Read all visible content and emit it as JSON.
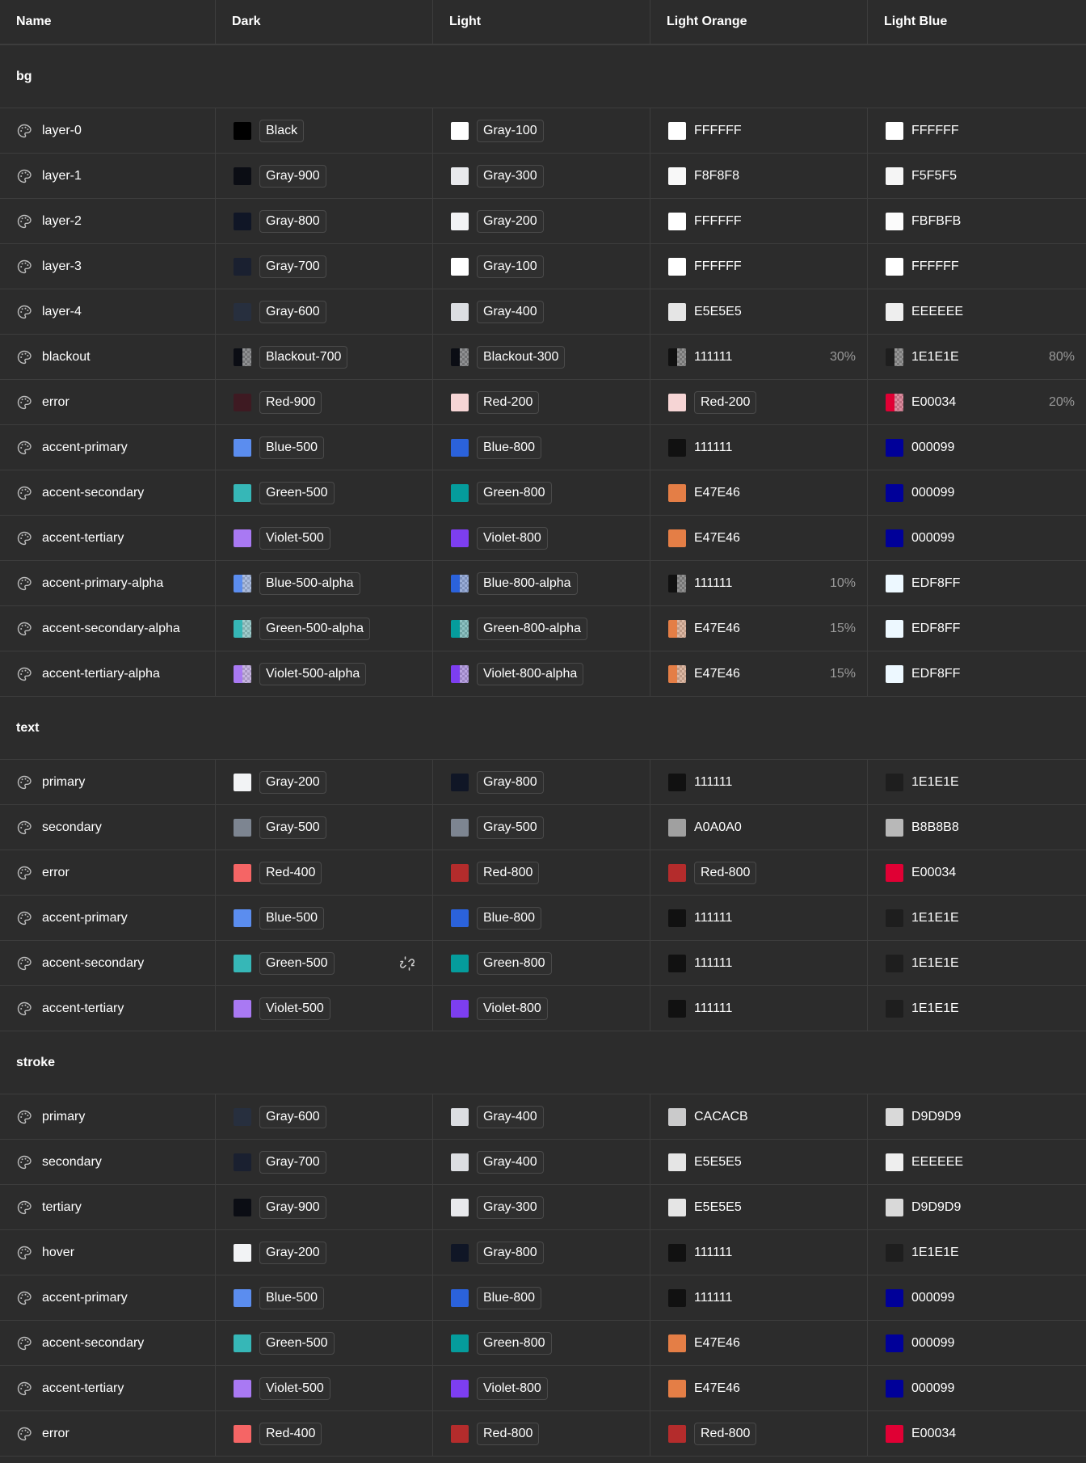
{
  "columns": [
    "Name",
    "Dark",
    "Light",
    "Light Orange",
    "Light Blue"
  ],
  "icons": {
    "row_icon": "palette-icon",
    "link_icon": "link-icon"
  },
  "sections": [
    {
      "title": "bg",
      "rows": [
        {
          "name": "layer-0",
          "cells": [
            {
              "type": "token",
              "label": "Black",
              "color": "#000000"
            },
            {
              "type": "token",
              "label": "Gray-100",
              "color": "#ffffff"
            },
            {
              "type": "hex",
              "label": "FFFFFF",
              "color": "#ffffff"
            },
            {
              "type": "hex",
              "label": "FFFFFF",
              "color": "#ffffff"
            }
          ]
        },
        {
          "name": "layer-1",
          "cells": [
            {
              "type": "token",
              "label": "Gray-900",
              "color": "#0b0d14"
            },
            {
              "type": "token",
              "label": "Gray-300",
              "color": "#e8e9ec"
            },
            {
              "type": "hex",
              "label": "F8F8F8",
              "color": "#f8f8f8"
            },
            {
              "type": "hex",
              "label": "F5F5F5",
              "color": "#f5f5f5"
            }
          ]
        },
        {
          "name": "layer-2",
          "cells": [
            {
              "type": "token",
              "label": "Gray-800",
              "color": "#101626"
            },
            {
              "type": "token",
              "label": "Gray-200",
              "color": "#f2f3f5"
            },
            {
              "type": "hex",
              "label": "FFFFFF",
              "color": "#ffffff"
            },
            {
              "type": "hex",
              "label": "FBFBFB",
              "color": "#fbfbfb"
            }
          ]
        },
        {
          "name": "layer-3",
          "cells": [
            {
              "type": "token",
              "label": "Gray-700",
              "color": "#1a2030"
            },
            {
              "type": "token",
              "label": "Gray-100",
              "color": "#ffffff"
            },
            {
              "type": "hex",
              "label": "FFFFFF",
              "color": "#ffffff"
            },
            {
              "type": "hex",
              "label": "FFFFFF",
              "color": "#ffffff"
            }
          ]
        },
        {
          "name": "layer-4",
          "cells": [
            {
              "type": "token",
              "label": "Gray-600",
              "color": "#272f3e"
            },
            {
              "type": "token",
              "label": "Gray-400",
              "color": "#dcdee2"
            },
            {
              "type": "hex",
              "label": "E5E5E5",
              "color": "#e5e5e5"
            },
            {
              "type": "hex",
              "label": "EEEEEE",
              "color": "#eeeeee"
            }
          ]
        },
        {
          "name": "blackout",
          "cells": [
            {
              "type": "token",
              "label": "Blackout-700",
              "color": "#0b0d14",
              "alpha": true
            },
            {
              "type": "token",
              "label": "Blackout-300",
              "color": "#0b0d14",
              "alpha": true
            },
            {
              "type": "hex",
              "label": "111111",
              "color": "#111111",
              "alpha": true,
              "pct": "30%"
            },
            {
              "type": "hex",
              "label": "1E1E1E",
              "color": "#1e1e1e",
              "alpha": true,
              "pct": "80%"
            }
          ]
        },
        {
          "name": "error",
          "cells": [
            {
              "type": "token",
              "label": "Red-900",
              "color": "#3e1a22"
            },
            {
              "type": "token",
              "label": "Red-200",
              "color": "#f6d5d5"
            },
            {
              "type": "token",
              "label": "Red-200",
              "color": "#f6d5d5"
            },
            {
              "type": "hex",
              "label": "E00034",
              "color": "#e00034",
              "alpha": true,
              "pct": "20%"
            }
          ]
        },
        {
          "name": "accent-primary",
          "cells": [
            {
              "type": "token",
              "label": "Blue-500",
              "color": "#5b8def"
            },
            {
              "type": "token",
              "label": "Blue-800",
              "color": "#2b62db"
            },
            {
              "type": "hex",
              "label": "111111",
              "color": "#111111"
            },
            {
              "type": "hex",
              "label": "000099",
              "color": "#000099"
            }
          ]
        },
        {
          "name": "accent-secondary",
          "cells": [
            {
              "type": "token",
              "label": "Green-500",
              "color": "#36b7b7"
            },
            {
              "type": "token",
              "label": "Green-800",
              "color": "#059c9c"
            },
            {
              "type": "hex",
              "label": "E47E46",
              "color": "#e47e46"
            },
            {
              "type": "hex",
              "label": "000099",
              "color": "#000099"
            }
          ]
        },
        {
          "name": "accent-tertiary",
          "cells": [
            {
              "type": "token",
              "label": "Violet-500",
              "color": "#a979f3"
            },
            {
              "type": "token",
              "label": "Violet-800",
              "color": "#7d3ef0"
            },
            {
              "type": "hex",
              "label": "E47E46",
              "color": "#e47e46"
            },
            {
              "type": "hex",
              "label": "000099",
              "color": "#000099"
            }
          ]
        },
        {
          "name": "accent-primary-alpha",
          "cells": [
            {
              "type": "token",
              "label": "Blue-500-alpha",
              "color": "#5b8def",
              "alpha": true
            },
            {
              "type": "token",
              "label": "Blue-800-alpha",
              "color": "#2b62db",
              "alpha": true
            },
            {
              "type": "hex",
              "label": "111111",
              "color": "#111111",
              "alpha": true,
              "pct": "10%"
            },
            {
              "type": "hex",
              "label": "EDF8FF",
              "color": "#edf8ff"
            }
          ]
        },
        {
          "name": "accent-secondary-alpha",
          "cells": [
            {
              "type": "token",
              "label": "Green-500-alpha",
              "color": "#36b7b7",
              "alpha": true
            },
            {
              "type": "token",
              "label": "Green-800-alpha",
              "color": "#059c9c",
              "alpha": true
            },
            {
              "type": "hex",
              "label": "E47E46",
              "color": "#e47e46",
              "alpha": true,
              "pct": "15%"
            },
            {
              "type": "hex",
              "label": "EDF8FF",
              "color": "#edf8ff"
            }
          ]
        },
        {
          "name": "accent-tertiary-alpha",
          "cells": [
            {
              "type": "token",
              "label": "Violet-500-alpha",
              "color": "#a979f3",
              "alpha": true
            },
            {
              "type": "token",
              "label": "Violet-800-alpha",
              "color": "#7d3ef0",
              "alpha": true
            },
            {
              "type": "hex",
              "label": "E47E46",
              "color": "#e47e46",
              "alpha": true,
              "pct": "15%"
            },
            {
              "type": "hex",
              "label": "EDF8FF",
              "color": "#edf8ff"
            }
          ]
        }
      ]
    },
    {
      "title": "text",
      "rows": [
        {
          "name": "primary",
          "cells": [
            {
              "type": "token",
              "label": "Gray-200",
              "color": "#f2f3f5"
            },
            {
              "type": "token",
              "label": "Gray-800",
              "color": "#101626"
            },
            {
              "type": "hex",
              "label": "111111",
              "color": "#111111"
            },
            {
              "type": "hex",
              "label": "1E1E1E",
              "color": "#1e1e1e"
            }
          ]
        },
        {
          "name": "secondary",
          "cells": [
            {
              "type": "token",
              "label": "Gray-500",
              "color": "#7d8591"
            },
            {
              "type": "token",
              "label": "Gray-500",
              "color": "#7d8591"
            },
            {
              "type": "hex",
              "label": "A0A0A0",
              "color": "#a0a0a0"
            },
            {
              "type": "hex",
              "label": "B8B8B8",
              "color": "#b8b8b8"
            }
          ]
        },
        {
          "name": "error",
          "cells": [
            {
              "type": "token",
              "label": "Red-400",
              "color": "#f56565"
            },
            {
              "type": "token",
              "label": "Red-800",
              "color": "#b42c2c"
            },
            {
              "type": "token",
              "label": "Red-800",
              "color": "#b42c2c"
            },
            {
              "type": "hex",
              "label": "E00034",
              "color": "#e00034"
            }
          ]
        },
        {
          "name": "accent-primary",
          "cells": [
            {
              "type": "token",
              "label": "Blue-500",
              "color": "#5b8def"
            },
            {
              "type": "token",
              "label": "Blue-800",
              "color": "#2b62db"
            },
            {
              "type": "hex",
              "label": "111111",
              "color": "#111111"
            },
            {
              "type": "hex",
              "label": "1E1E1E",
              "color": "#1e1e1e"
            }
          ]
        },
        {
          "name": "accent-secondary",
          "link": true,
          "cells": [
            {
              "type": "token",
              "label": "Green-500",
              "color": "#36b7b7"
            },
            {
              "type": "token",
              "label": "Green-800",
              "color": "#059c9c"
            },
            {
              "type": "hex",
              "label": "111111",
              "color": "#111111"
            },
            {
              "type": "hex",
              "label": "1E1E1E",
              "color": "#1e1e1e"
            }
          ]
        },
        {
          "name": "accent-tertiary",
          "cells": [
            {
              "type": "token",
              "label": "Violet-500",
              "color": "#a979f3"
            },
            {
              "type": "token",
              "label": "Violet-800",
              "color": "#7d3ef0"
            },
            {
              "type": "hex",
              "label": "111111",
              "color": "#111111"
            },
            {
              "type": "hex",
              "label": "1E1E1E",
              "color": "#1e1e1e"
            }
          ]
        }
      ]
    },
    {
      "title": "stroke",
      "rows": [
        {
          "name": "primary",
          "cells": [
            {
              "type": "token",
              "label": "Gray-600",
              "color": "#272f3e"
            },
            {
              "type": "token",
              "label": "Gray-400",
              "color": "#dcdee2"
            },
            {
              "type": "hex",
              "label": "CACACB",
              "color": "#cacacb"
            },
            {
              "type": "hex",
              "label": "D9D9D9",
              "color": "#d9d9d9"
            }
          ]
        },
        {
          "name": "secondary",
          "cells": [
            {
              "type": "token",
              "label": "Gray-700",
              "color": "#1a2030"
            },
            {
              "type": "token",
              "label": "Gray-400",
              "color": "#dcdee2"
            },
            {
              "type": "hex",
              "label": "E5E5E5",
              "color": "#e5e5e5"
            },
            {
              "type": "hex",
              "label": "EEEEEE",
              "color": "#eeeeee"
            }
          ]
        },
        {
          "name": "tertiary",
          "cells": [
            {
              "type": "token",
              "label": "Gray-900",
              "color": "#0b0d14"
            },
            {
              "type": "token",
              "label": "Gray-300",
              "color": "#e8e9ec"
            },
            {
              "type": "hex",
              "label": "E5E5E5",
              "color": "#e5e5e5"
            },
            {
              "type": "hex",
              "label": "D9D9D9",
              "color": "#d9d9d9"
            }
          ]
        },
        {
          "name": "hover",
          "cells": [
            {
              "type": "token",
              "label": "Gray-200",
              "color": "#f2f3f5"
            },
            {
              "type": "token",
              "label": "Gray-800",
              "color": "#101626"
            },
            {
              "type": "hex",
              "label": "111111",
              "color": "#111111"
            },
            {
              "type": "hex",
              "label": "1E1E1E",
              "color": "#1e1e1e"
            }
          ]
        },
        {
          "name": "accent-primary",
          "cells": [
            {
              "type": "token",
              "label": "Blue-500",
              "color": "#5b8def"
            },
            {
              "type": "token",
              "label": "Blue-800",
              "color": "#2b62db"
            },
            {
              "type": "hex",
              "label": "111111",
              "color": "#111111"
            },
            {
              "type": "hex",
              "label": "000099",
              "color": "#000099"
            }
          ]
        },
        {
          "name": "accent-secondary",
          "cells": [
            {
              "type": "token",
              "label": "Green-500",
              "color": "#36b7b7"
            },
            {
              "type": "token",
              "label": "Green-800",
              "color": "#059c9c"
            },
            {
              "type": "hex",
              "label": "E47E46",
              "color": "#e47e46"
            },
            {
              "type": "hex",
              "label": "000099",
              "color": "#000099"
            }
          ]
        },
        {
          "name": "accent-tertiary",
          "cells": [
            {
              "type": "token",
              "label": "Violet-500",
              "color": "#a979f3"
            },
            {
              "type": "token",
              "label": "Violet-800",
              "color": "#7d3ef0"
            },
            {
              "type": "hex",
              "label": "E47E46",
              "color": "#e47e46"
            },
            {
              "type": "hex",
              "label": "000099",
              "color": "#000099"
            }
          ]
        },
        {
          "name": "error",
          "cells": [
            {
              "type": "token",
              "label": "Red-400",
              "color": "#f56565"
            },
            {
              "type": "token",
              "label": "Red-800",
              "color": "#b42c2c"
            },
            {
              "type": "token",
              "label": "Red-800",
              "color": "#b42c2c"
            },
            {
              "type": "hex",
              "label": "E00034",
              "color": "#e00034"
            }
          ]
        }
      ]
    }
  ]
}
